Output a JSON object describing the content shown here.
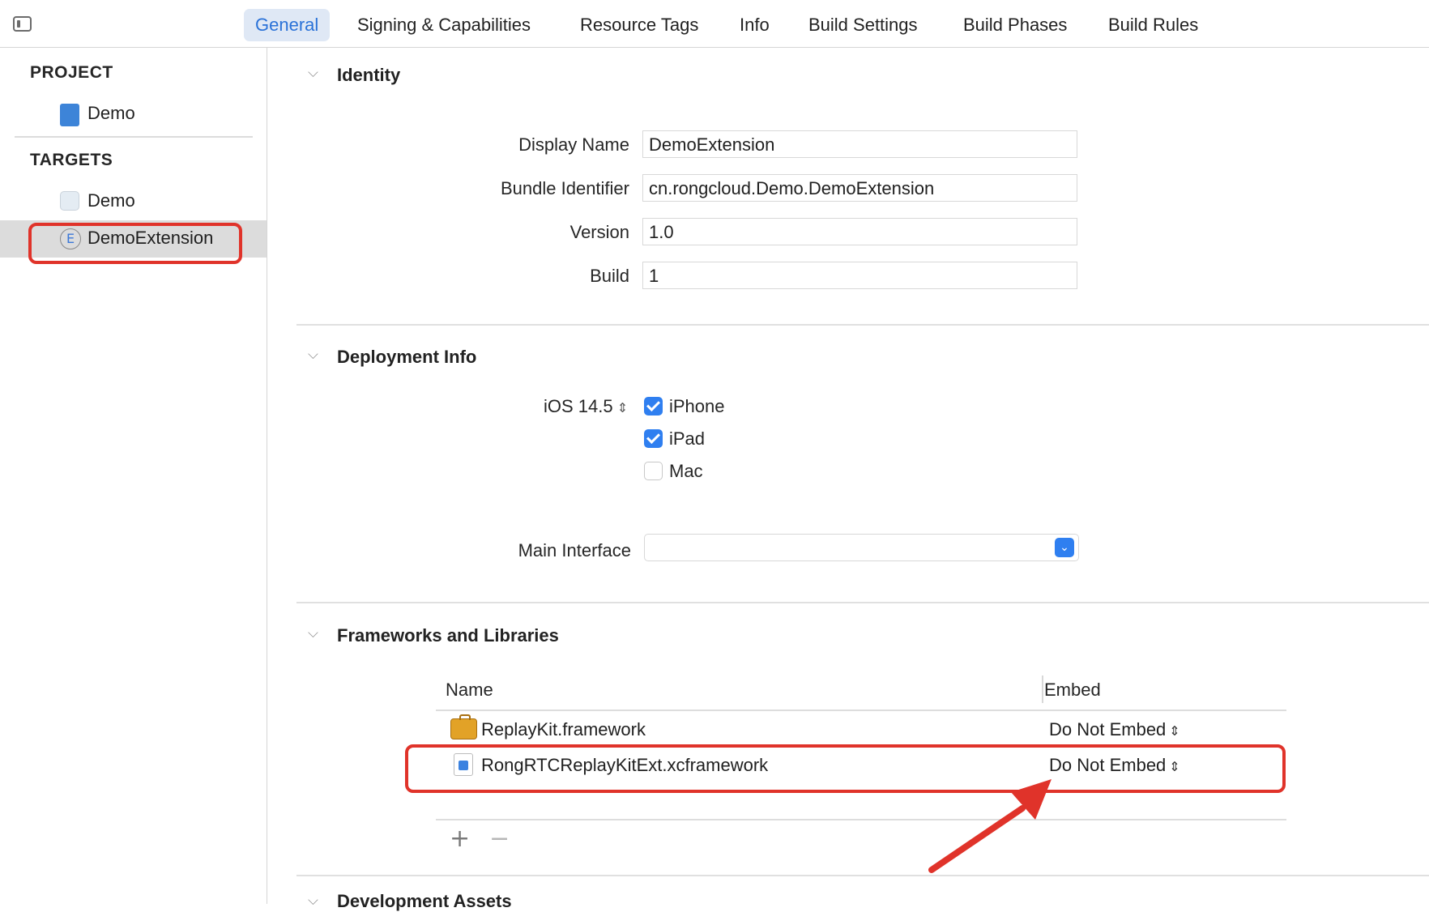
{
  "tabs": [
    "General",
    "Signing & Capabilities",
    "Resource Tags",
    "Info",
    "Build Settings",
    "Build Phases",
    "Build Rules"
  ],
  "sidebar": {
    "project_heading": "PROJECT",
    "project_item": "Demo",
    "targets_heading": "TARGETS",
    "target_items": [
      "Demo",
      "DemoExtension"
    ],
    "ext_icon_letter": "E"
  },
  "identity": {
    "title": "Identity",
    "display_name_label": "Display Name",
    "display_name_value": "DemoExtension",
    "bundle_id_label": "Bundle Identifier",
    "bundle_id_value": "cn.rongcloud.Demo.DemoExtension",
    "version_label": "Version",
    "version_value": "1.0",
    "build_label": "Build",
    "build_value": "1"
  },
  "deployment": {
    "title": "Deployment Info",
    "ios_version": "iOS 14.5",
    "devices": [
      {
        "label": "iPhone",
        "checked": true
      },
      {
        "label": "iPad",
        "checked": true
      },
      {
        "label": "Mac",
        "checked": false
      }
    ],
    "main_interface_label": "Main Interface",
    "main_interface_value": ""
  },
  "frameworks": {
    "title": "Frameworks and Libraries",
    "col_name": "Name",
    "col_embed": "Embed",
    "rows": [
      {
        "name": "ReplayKit.framework",
        "embed": "Do Not Embed",
        "icon": "toolbox-icon"
      },
      {
        "name": "RongRTCReplayKitExt.xcframework",
        "embed": "Do Not Embed",
        "icon": "xcframework-icon"
      }
    ]
  },
  "next_section": {
    "title": "Development Assets"
  },
  "colors": {
    "accent": "#2f7ff0",
    "highlight": "#e0332a",
    "active_tab_bg": "#dfe8f5"
  }
}
